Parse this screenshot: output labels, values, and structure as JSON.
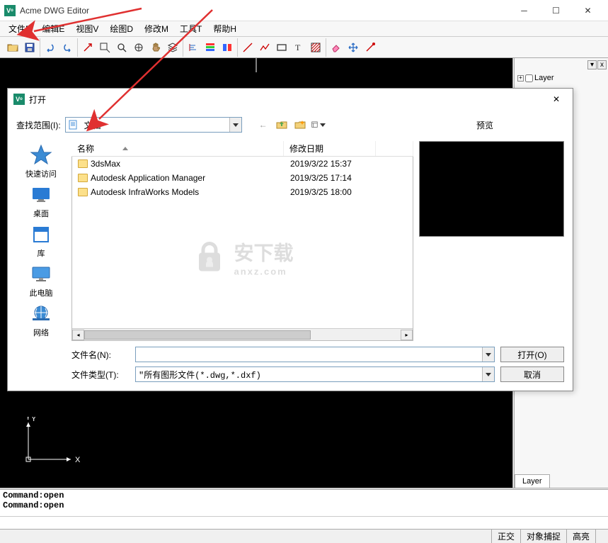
{
  "app": {
    "title": "Acme DWG Editor"
  },
  "menu": {
    "file": "文件F",
    "edit": "编辑E",
    "view": "视图V",
    "draw": "绘图D",
    "modify": "修改M",
    "tool": "工具T",
    "help": "帮助H"
  },
  "side": {
    "layer": "Layer",
    "tab": "Layer"
  },
  "axis": {
    "x": "X",
    "y": "Y"
  },
  "cmd": {
    "line1": "Command:open",
    "line2": "Command:open"
  },
  "status": {
    "ortho": "正交",
    "osnap": "对象捕捉",
    "highlight": "高亮"
  },
  "dialog": {
    "title": "打开",
    "lookin_label": "查找范围(I):",
    "lookin_value": "文档",
    "preview_label": "预览",
    "col_name": "名称",
    "col_date": "修改日期",
    "files": [
      {
        "name": "3dsMax",
        "date": "2019/3/22 15:37"
      },
      {
        "name": "Autodesk Application Manager",
        "date": "2019/3/25 17:14"
      },
      {
        "name": "Autodesk InfraWorks Models",
        "date": "2019/3/25 18:00"
      }
    ],
    "places": {
      "quick": "快速访问",
      "desktop": "桌面",
      "library": "库",
      "thispc": "此电脑",
      "network": "网络"
    },
    "filename_label": "文件名(N):",
    "filename_value": "",
    "filetype_label": "文件类型(T):",
    "filetype_value": "\"所有图形文件(*.dwg,*.dxf)",
    "open_btn": "打开(O)",
    "cancel_btn": "取消"
  },
  "watermark": {
    "main": "安下载",
    "sub": "anxz.com"
  }
}
